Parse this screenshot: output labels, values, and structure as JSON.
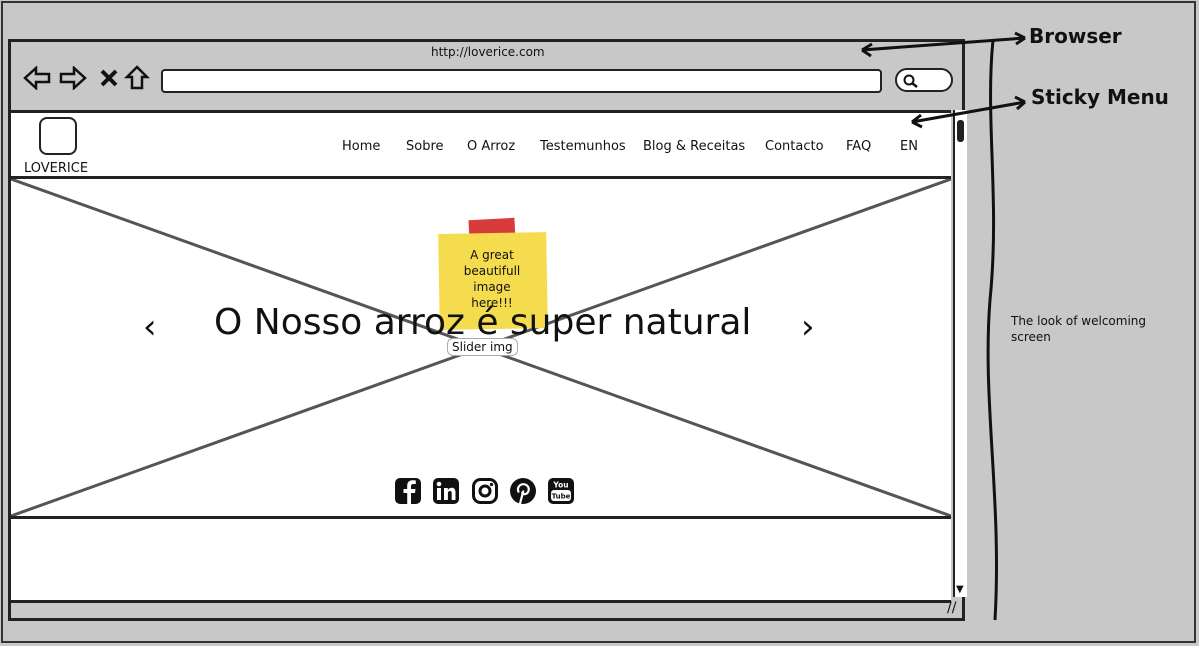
{
  "browser": {
    "url": "http://loverice.com"
  },
  "site": {
    "logo_text": "LOVERICE",
    "menu": [
      "Home",
      "Sobre",
      "O Arroz",
      "Testemunhos",
      "Blog & Receitas",
      "Contacto",
      "FAQ",
      "EN"
    ],
    "slider": {
      "headline": "O Nosso arroz é super natural",
      "prev": "‹",
      "next": "›",
      "note": "A great beautifull image here!!!",
      "label": "Slider img"
    },
    "social_icons": [
      "facebook-icon",
      "linkedin-icon",
      "instagram-icon",
      "pinterest-icon",
      "youtube-icon"
    ]
  },
  "annotations": {
    "browser": "Browser",
    "sticky_menu": "Sticky Menu",
    "welcome": "The look of welcoming screen"
  }
}
